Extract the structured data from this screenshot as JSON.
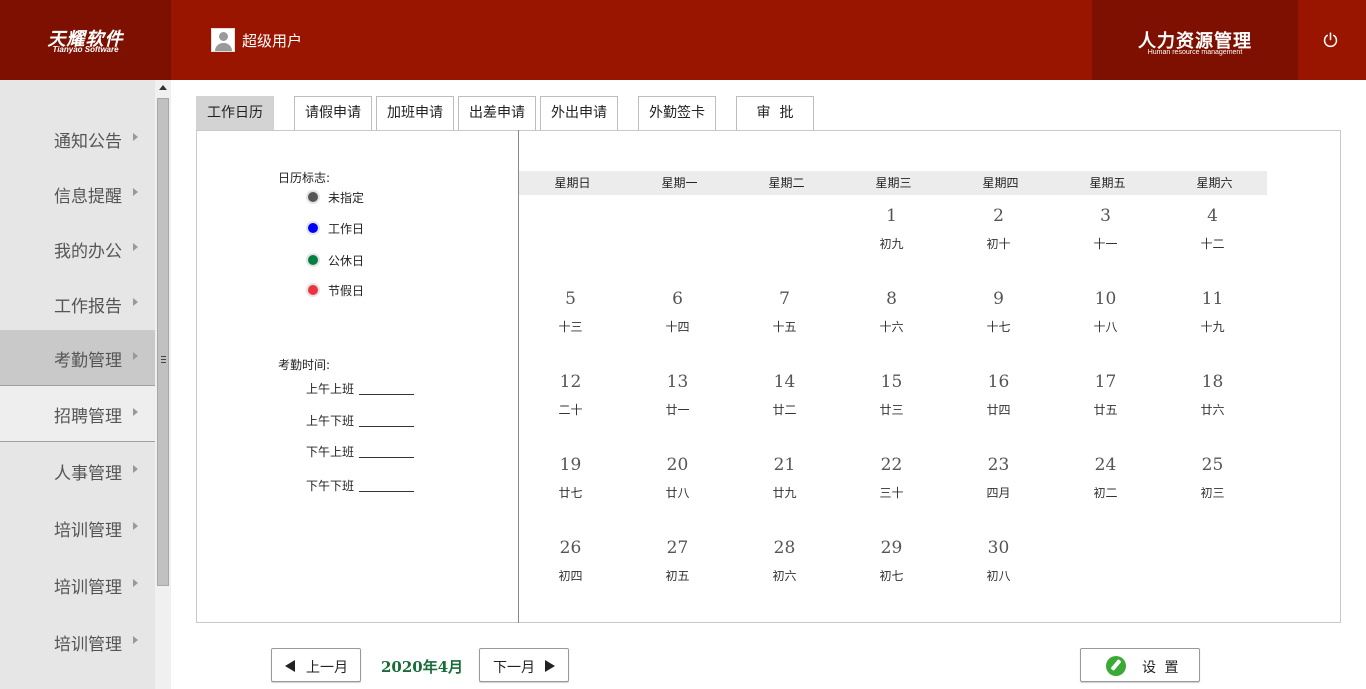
{
  "header": {
    "logo_main": "天耀软件",
    "logo_sub": "Tianyao Software",
    "user_name": "超级用户",
    "system_title": "人力资源管理",
    "system_subtitle": "Human resource management"
  },
  "sidebar": {
    "items": [
      {
        "label": "通知公告"
      },
      {
        "label": "信息提醒"
      },
      {
        "label": "我的办公"
      },
      {
        "label": "工作报告"
      },
      {
        "label": "考勤管理"
      },
      {
        "label": "招聘管理"
      },
      {
        "label": "人事管理"
      },
      {
        "label": "培训管理"
      },
      {
        "label": "培训管理"
      },
      {
        "label": "培训管理"
      }
    ]
  },
  "tabs": [
    {
      "label": "工作日历"
    },
    {
      "label": "请假申请"
    },
    {
      "label": "加班申请"
    },
    {
      "label": "出差申请"
    },
    {
      "label": "外出申请"
    },
    {
      "label": "外勤签卡"
    },
    {
      "label": "审  批"
    }
  ],
  "legend": {
    "title": "日历标志:",
    "items": [
      {
        "label": "未指定",
        "color": "#555555"
      },
      {
        "label": "工作日",
        "color": "#0000ff"
      },
      {
        "label": "公休日",
        "color": "#008040"
      },
      {
        "label": "节假日",
        "color": "#ee3340"
      }
    ]
  },
  "attendance": {
    "title": "考勤时间:",
    "rows": [
      {
        "label": "上午上班"
      },
      {
        "label": "上午下班"
      },
      {
        "label": "下午上班"
      },
      {
        "label": "下午下班"
      }
    ]
  },
  "calendar": {
    "weekdays": [
      "星期日",
      "星期一",
      "星期二",
      "星期三",
      "星期四",
      "星期五",
      "星期六"
    ],
    "days": [
      {
        "day": "1",
        "lunar": "初九"
      },
      {
        "day": "2",
        "lunar": "初十"
      },
      {
        "day": "3",
        "lunar": "十一"
      },
      {
        "day": "4",
        "lunar": "十二"
      },
      {
        "day": "5",
        "lunar": "十三"
      },
      {
        "day": "6",
        "lunar": "十四"
      },
      {
        "day": "7",
        "lunar": "十五"
      },
      {
        "day": "8",
        "lunar": "十六"
      },
      {
        "day": "9",
        "lunar": "十七"
      },
      {
        "day": "10",
        "lunar": "十八"
      },
      {
        "day": "11",
        "lunar": "十九"
      },
      {
        "day": "12",
        "lunar": "二十"
      },
      {
        "day": "13",
        "lunar": "廿一"
      },
      {
        "day": "14",
        "lunar": "廿二"
      },
      {
        "day": "15",
        "lunar": "廿三"
      },
      {
        "day": "16",
        "lunar": "廿四"
      },
      {
        "day": "17",
        "lunar": "廿五"
      },
      {
        "day": "18",
        "lunar": "廿六"
      },
      {
        "day": "19",
        "lunar": "廿七"
      },
      {
        "day": "20",
        "lunar": "廿八"
      },
      {
        "day": "21",
        "lunar": "廿九"
      },
      {
        "day": "22",
        "lunar": "三十"
      },
      {
        "day": "23",
        "lunar": "四月"
      },
      {
        "day": "24",
        "lunar": "初二"
      },
      {
        "day": "25",
        "lunar": "初三"
      },
      {
        "day": "26",
        "lunar": "初四"
      },
      {
        "day": "27",
        "lunar": "初五"
      },
      {
        "day": "28",
        "lunar": "初六"
      },
      {
        "day": "29",
        "lunar": "初七"
      },
      {
        "day": "30",
        "lunar": "初八"
      }
    ]
  },
  "footer": {
    "prev_label": "上一月",
    "current_month": "2020年4月",
    "next_label": "下一月",
    "settings_label": "设 置"
  }
}
